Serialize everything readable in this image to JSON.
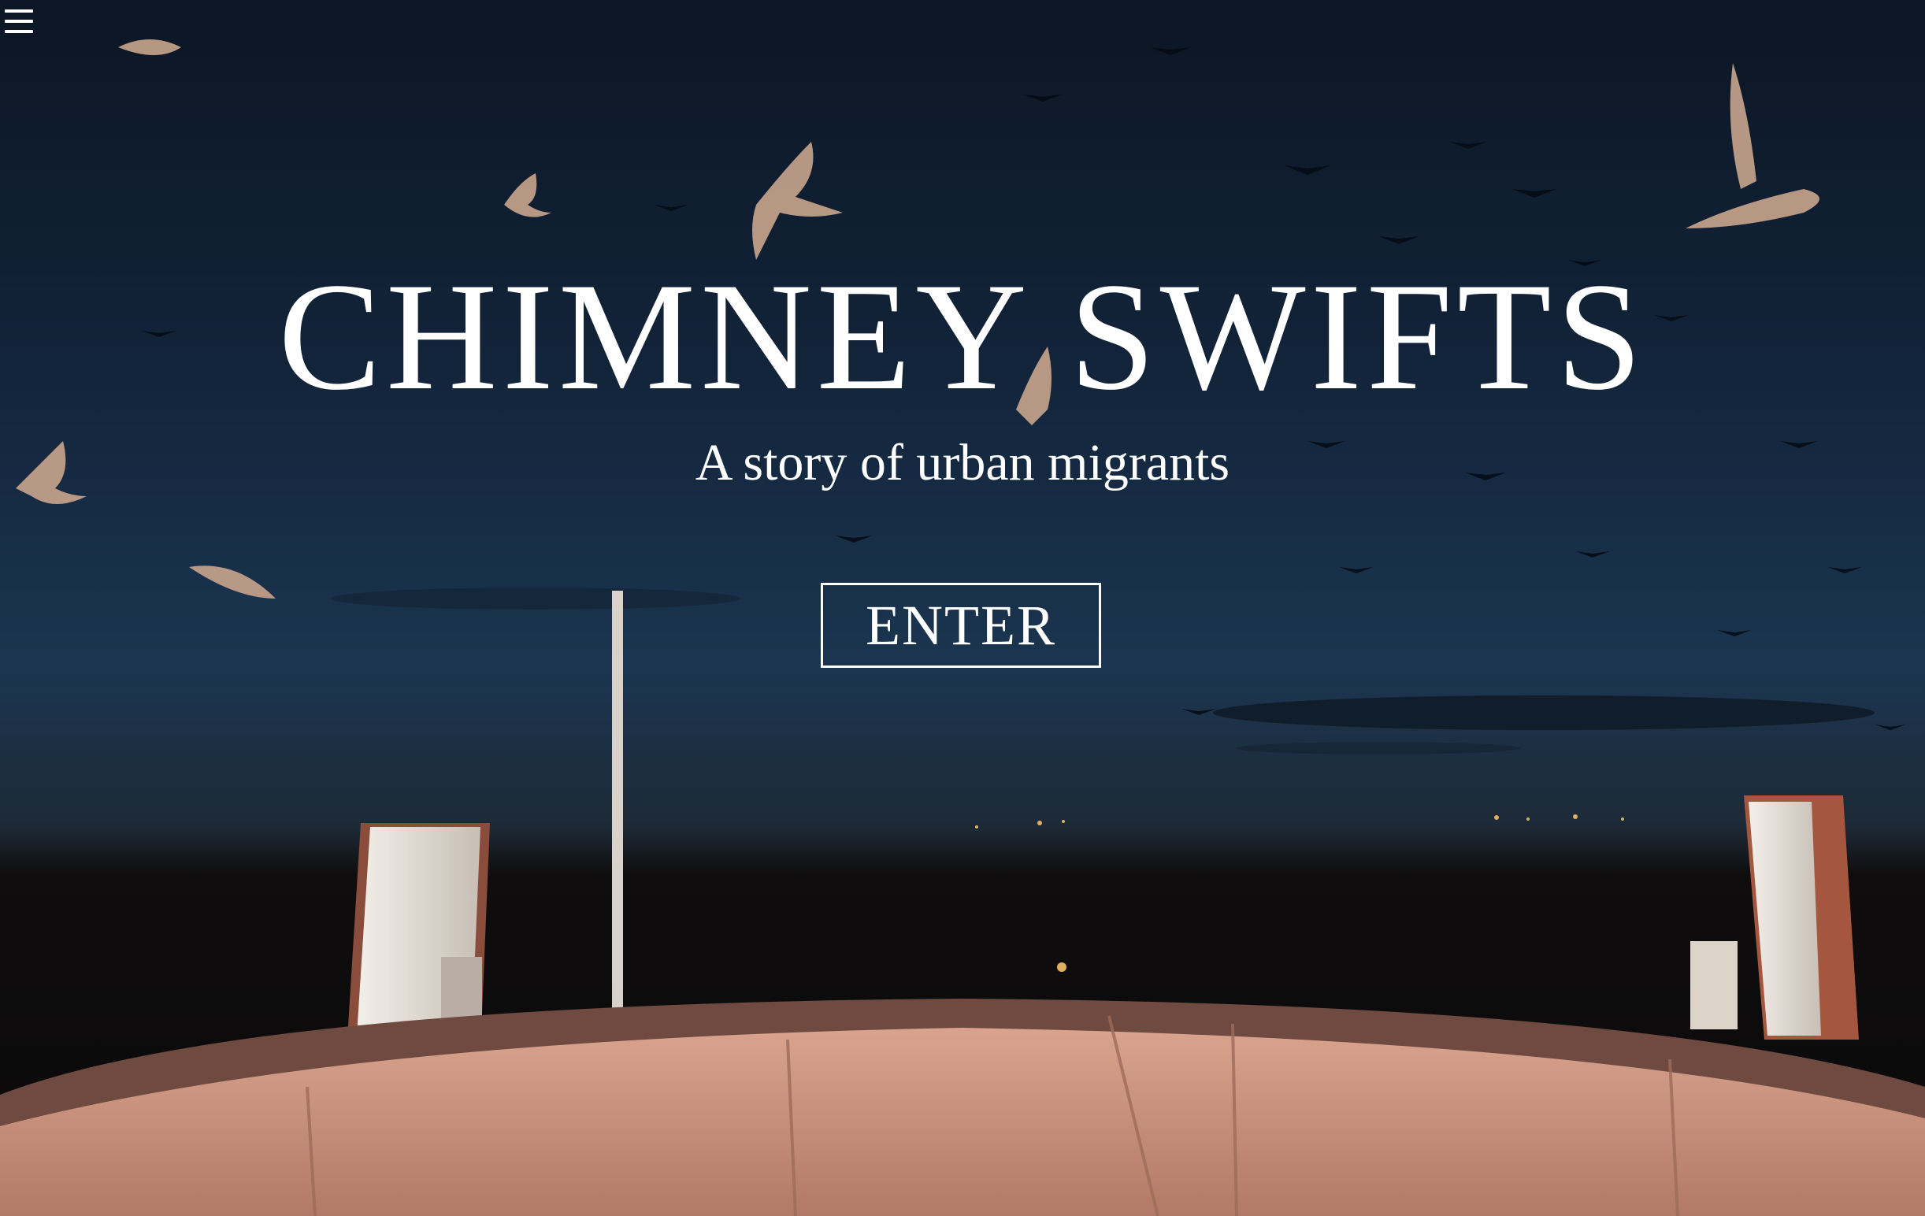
{
  "hero": {
    "title": "CHIMNEY SWIFTS",
    "subtitle": "A story of urban migrants",
    "enter_label": "ENTER"
  },
  "nav": {
    "menu_icon": "hamburger-menu-icon"
  },
  "colors": {
    "text": "#ffffff",
    "sky_top": "#0c1624",
    "sky_horizon": "#1b3550",
    "chimney_rim": "#c9907a"
  }
}
